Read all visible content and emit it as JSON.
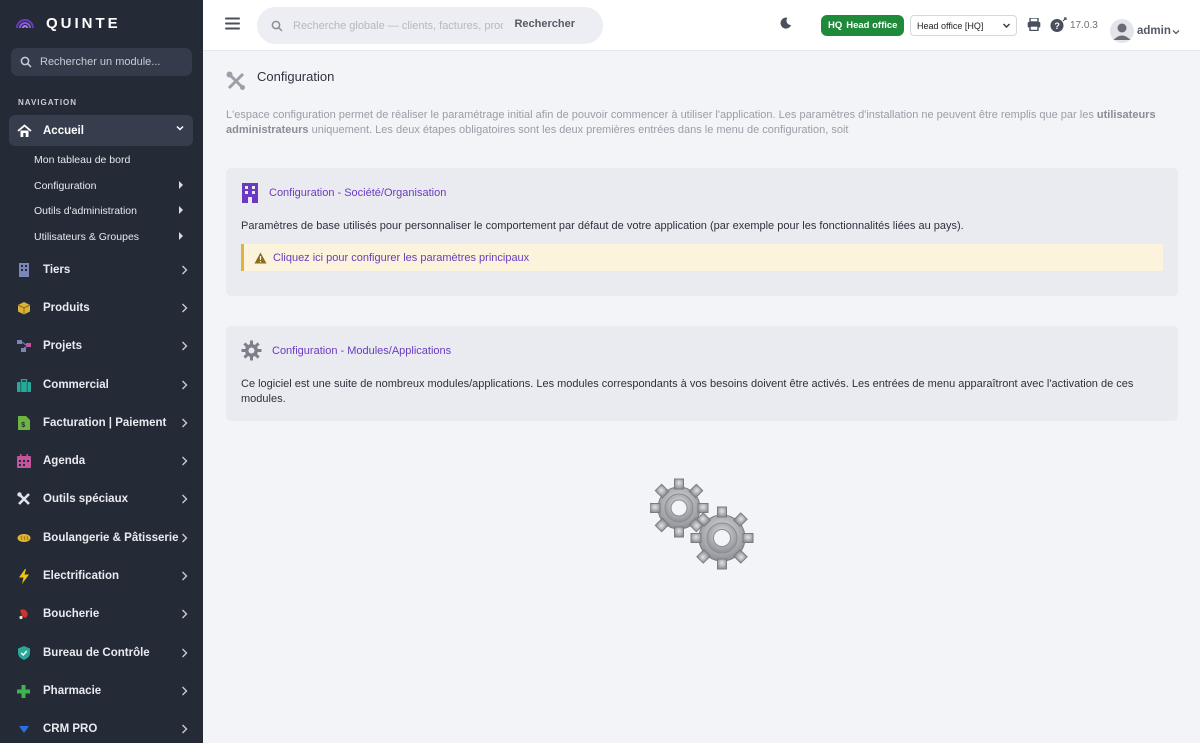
{
  "brand": {
    "name": "QUINTE"
  },
  "sidebar": {
    "search_placeholder": "Rechercher un module...",
    "nav_title": "NAVIGATION",
    "active": {
      "label": "Accueil",
      "icon": "home-icon"
    },
    "subitems": [
      {
        "label": "Mon tableau de bord"
      },
      {
        "label": "Configuration"
      },
      {
        "label": "Outils d'administration"
      },
      {
        "label": "Utilisateurs & Groupes"
      }
    ],
    "items": [
      {
        "label": "Tiers",
        "icon": "building-icon",
        "color": "#7b86b8"
      },
      {
        "label": "Produits",
        "icon": "box-icon",
        "color": "#d9b23a"
      },
      {
        "label": "Projets",
        "icon": "project-icon",
        "color": "#7b86b8"
      },
      {
        "label": "Commercial",
        "icon": "briefcase-icon",
        "color": "#2aa89a"
      },
      {
        "label": "Facturation | Paiement",
        "icon": "invoice-icon",
        "color": "#6db33f"
      },
      {
        "label": "Agenda",
        "icon": "calendar-icon",
        "color": "#c4559a"
      },
      {
        "label": "Outils spéciaux",
        "icon": "tools-icon",
        "color": "#dfe2ea"
      },
      {
        "label": "Boulangerie & Pâtisserie",
        "icon": "bread-icon",
        "color": "#e5b531"
      },
      {
        "label": "Electrification",
        "icon": "bolt-icon",
        "color": "#f1c40f"
      },
      {
        "label": "Boucherie",
        "icon": "meat-icon",
        "color": "#d0312d"
      },
      {
        "label": "Bureau de Contrôle",
        "icon": "shield-icon",
        "color": "#2aa89a"
      },
      {
        "label": "Pharmacie",
        "icon": "cross-icon",
        "color": "#3fb34f"
      },
      {
        "label": "CRM PRO",
        "icon": "crm-icon",
        "color": "#2d6fe0"
      }
    ]
  },
  "topbar": {
    "search_placeholder": "Recherche globale — clients, factures, prod",
    "search_button": "Rechercher",
    "hq_badge": {
      "code": "HQ",
      "label": "Head office"
    },
    "entity_selected": "Head office [HQ]",
    "version": "17.0.3",
    "user": "admin"
  },
  "main": {
    "title": "Configuration",
    "intro_part1": "L'espace configuration permet de réaliser le paramétrage initial afin de pouvoir commencer à utiliser l'application. Les paramètres d'installation ne peuvent être remplis que par les ",
    "intro_bold": "utilisateurs administrateurs",
    "intro_part2": " uniquement. Les deux étapes obligatoires sont les deux premières entrées dans le menu de configuration, soit",
    "card1": {
      "link": "Configuration - Société/Organisation",
      "text": "Paramètres de base utilisés pour personnaliser le comportement par défaut de votre application (par exemple pour les fonctionnalités liées au pays).",
      "warning_link": "Cliquez ici pour configurer les paramètres principaux"
    },
    "card2": {
      "link": "Configuration - Modules/Applications",
      "text": "Ce logiciel est une suite de nombreux modules/applications. Les modules correspondants à vos besoins doivent être activés. Les entrées de menu apparaîtront avec l'activation de ces modules."
    }
  }
}
